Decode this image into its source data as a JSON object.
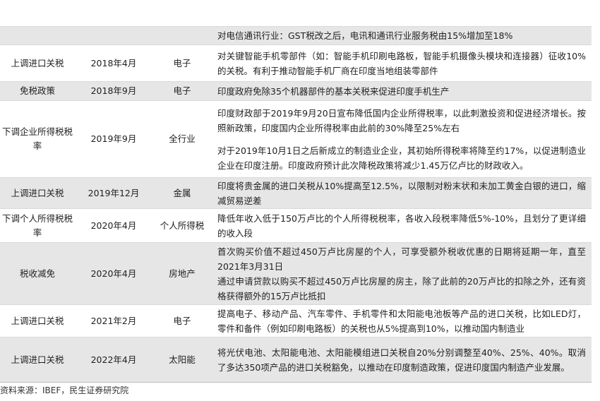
{
  "rows": [
    {
      "name": "",
      "date": "",
      "industry": "",
      "desc": [
        "对电信通讯行业：GST税改之后，电讯和通讯行业服务税由15%增加至18%"
      ]
    },
    {
      "name": "上调进口关税",
      "date": "2018年4月",
      "industry": "电子",
      "desc": [
        "对关键智能手机零部件（如：智能手机印刷电路板，智能手机摄像头模块和连接器）征收10%的关税。有利于推动智能手机厂商在印度当地组装零部件"
      ]
    },
    {
      "name": "免税政策",
      "date": "2018年9月",
      "industry": "电子",
      "desc": [
        "印度政府免除35个机器部件的基本关税来促进印度手机生产"
      ]
    },
    {
      "name": "下调企业所得税税率",
      "date": "2019年9月",
      "industry": "全行业",
      "desc": [
        "印度财政部于2019年9月20日宣布降低国内企业所得税率，以此刺激投资和促进经济增长。按照新政策，印度国内企业所得税率由此前的30%降至25%左右",
        "对于2019年10月1日之后新成立的制造业企业，其初始所得税率将降至约17%，以促进制造业企业在印度注册。印度政府预计此次降税政策将减少1.45万亿卢比的财政收入。"
      ]
    },
    {
      "name": "上调进口关税",
      "date": "2019年12月",
      "industry": "金属",
      "desc": [
        "印度将贵金属的进口关税从10%提高至12.5%，以限制对粉末状和未加工黄金白银的进口，缩减贸易逆差"
      ]
    },
    {
      "name": "下调个人所得税税率",
      "date": "2020年4月",
      "industry": "个人所得税",
      "desc": [
        "降低年收入低于150万卢比的个人所得税税率，各收入段税率降低5%-10%，且划分了更详细的收入段"
      ]
    },
    {
      "name": "税收减免",
      "date": "2020年4月",
      "industry": "房地产",
      "desc": [
        "首次购买价值不超过450万卢比房屋的个人，可享受额外税收优惠的日期将延期一年，直至2021年3月31日",
        "通过申请贷款以购买不超过450万卢比房屋的房主，除了此前的20万卢比的扣除之外，还有资格获得额外的15万卢比抵扣"
      ]
    },
    {
      "name": "上调进口关税",
      "date": "2021年2月",
      "industry": "电子",
      "desc": [
        "提高电子、移动产品、汽车零件、手机零件和太阳能电池板等产品的进口关税，比如LED灯，零件和备件（例如印刷电路板）的关税也从5%提高到10%，以推动国内制造业"
      ]
    },
    {
      "name": "上调进口关税",
      "date": "2022年4月",
      "industry": "太阳能",
      "desc": [
        "将光伏电池、太阳能电池、太阳能模组进口关税自20%分别调整至40%、25%、40%。取消了多达350项产品的进口关税豁免，以推动在印度制造政策，促进印度国内制造产业发展。"
      ]
    }
  ],
  "source": "资料来源：IBEF，民生证券研究院"
}
